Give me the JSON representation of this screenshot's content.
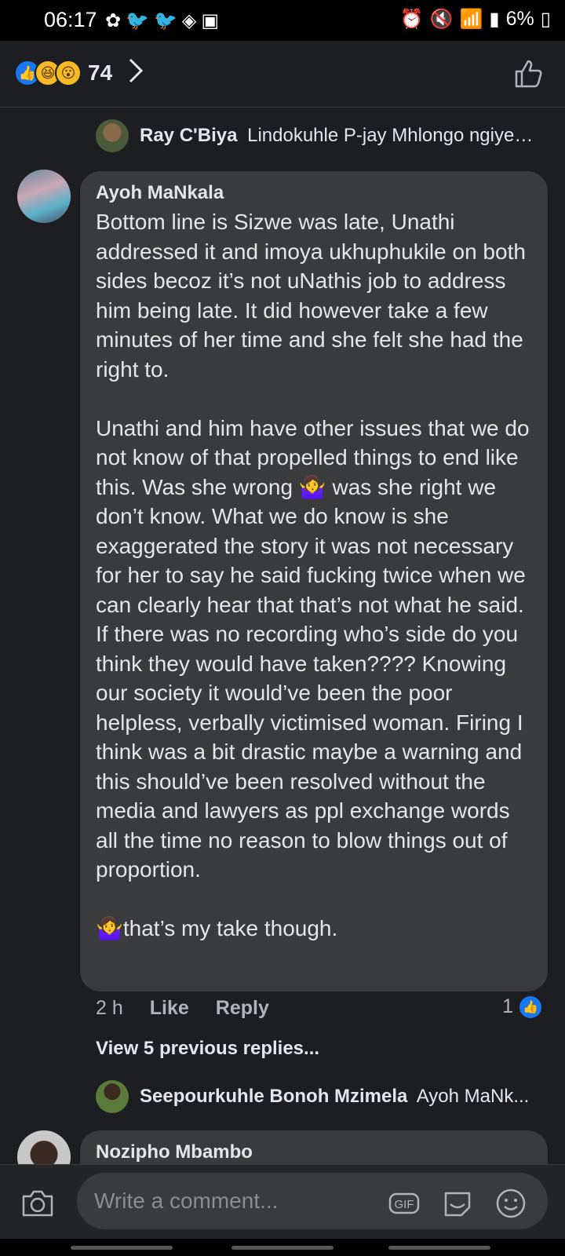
{
  "status_bar": {
    "time": "06:17",
    "battery": "6%",
    "left_icons": [
      "sunflower-icon",
      "twitter-icon",
      "twitter-icon",
      "diamond-icon",
      "gallery-icon"
    ],
    "right_icons": [
      "alarm-icon",
      "mute-icon",
      "wifi-icon",
      "signal-icon",
      "signal-icon"
    ]
  },
  "header": {
    "reaction_count": "74",
    "reactions": [
      "like-icon",
      "haha-icon",
      "wow-icon"
    ]
  },
  "reply_preview_1": {
    "author": "Ray C'Biya",
    "text": "Lindokuhle P-jay Mhlongo ngiyez..."
  },
  "comment": {
    "author": "Ayoh MaNkala",
    "body": "Bottom line is Sizwe was late, Unathi addressed it and imoya ukhuphukile on both sides becoz it’s not uNathis job to address him being late. It did however take a few minutes of her time and she felt she had the right to.\n\nUnathi and him have other issues that we do not know of that propelled things to end like this. Was she wrong 🤷‍♀️ was she right we don’t know. What we do know is she exaggerated the story it was not necessary for her to say he said fucking twice when we can clearly hear that that’s not what he said. If there was no recording who’s side do you think they would have taken???? Knowing our society it would’ve been the poor helpless, verbally victimised woman. Firing I think was a bit drastic maybe a warning and this should’ve been resolved without the media and lawyers as ppl exchange words all the time no reason to blow things out of proportion.\n\n🤷‍♀️that’s my take though.",
    "time": "2 h",
    "like_label": "Like",
    "reply_label": "Reply",
    "like_count": "1"
  },
  "view_previous": "View 5 previous replies...",
  "reply_preview_2": {
    "author": "Seepourkuhle Bonoh Mzimela",
    "text": "Ayoh MaNk..."
  },
  "next_comment": {
    "author": "Nozipho Mbambo"
  },
  "composer": {
    "placeholder": "Write a comment...",
    "gif_label": "GIF"
  },
  "colors": {
    "background": "#1c1e21",
    "bubble": "#3a3b3c",
    "accent": "#1877f2"
  }
}
